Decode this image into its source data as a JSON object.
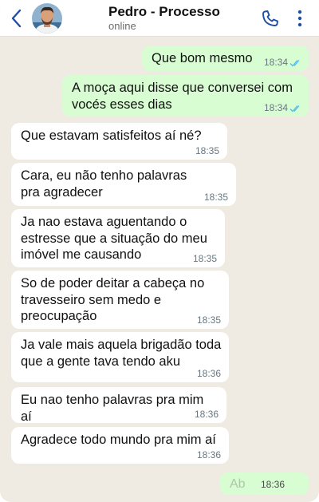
{
  "header": {
    "contact_name": "Pedro - Processo",
    "status": "online",
    "icons": [
      "chevron-left-icon",
      "avatar",
      "phone-icon",
      "more-vertical-icon"
    ]
  },
  "colors": {
    "accent": "#1f4fa8",
    "outgoing_bubble": "#d9fdd3",
    "incoming_bubble": "#ffffff",
    "chat_background": "#efeae2",
    "read_check": "#53bdeb"
  },
  "messages": [
    {
      "direction": "out",
      "text": "Que bom mesmo",
      "time": "18:34",
      "read": true
    },
    {
      "direction": "out",
      "text": "A moça aqui disse que conversei com vocés esses dias",
      "time": "18:34",
      "read": true
    },
    {
      "direction": "in",
      "text": "Que estavam satisfeitos aí né?",
      "time": "18:35"
    },
    {
      "direction": "in",
      "text": "Cara, eu não tenho palavras pra agradecer",
      "time": "18:35"
    },
    {
      "direction": "in",
      "text": "Ja nao estava aguentando o estresse que a situação do meu imóvel me causando",
      "time": "18:35"
    },
    {
      "direction": "in",
      "text": "So de poder deitar a cabeça no travesseiro sem medo e preocupação",
      "time": "18:35"
    },
    {
      "direction": "in",
      "text": "Ja vale mais aquela brigadão toda que a gente tava tendo aku",
      "time": "18:36"
    },
    {
      "direction": "in",
      "text": "Eu nao tenho palavras pra mim aí",
      "time": "18:36"
    },
    {
      "direction": "in",
      "text": "Agradece todo mundo pra mim aí",
      "time": "18:36"
    }
  ],
  "pending": {
    "partial_text": "Ab",
    "time": "18:36"
  }
}
